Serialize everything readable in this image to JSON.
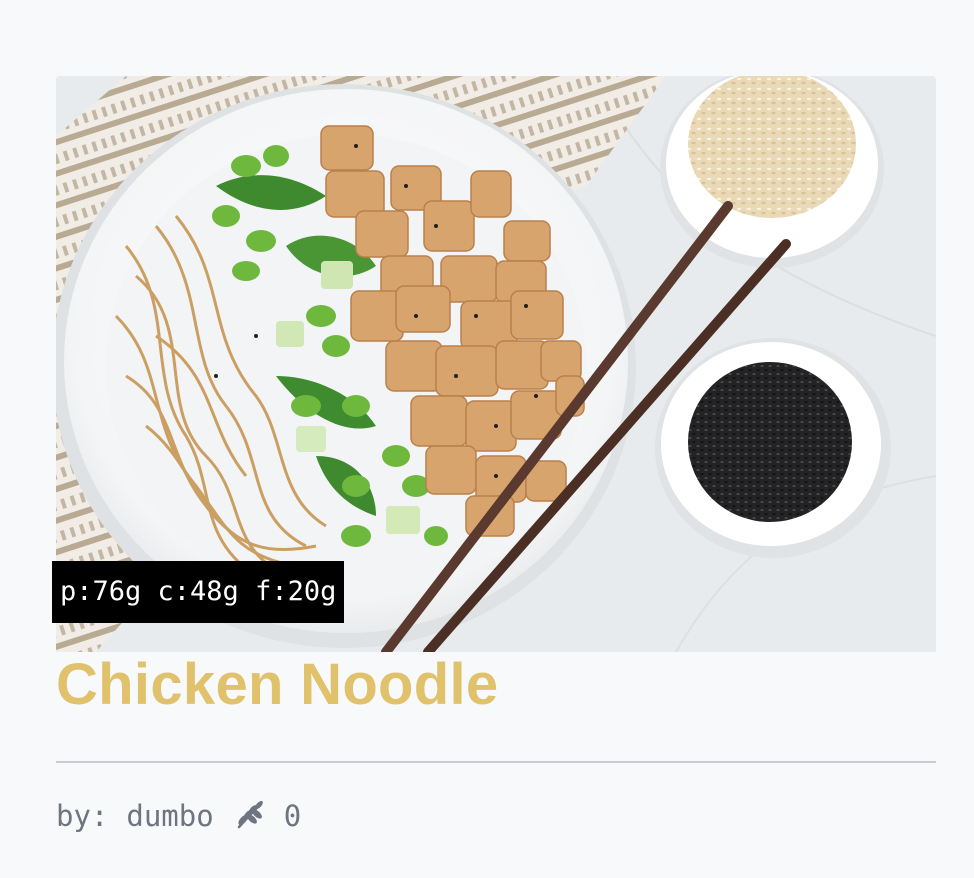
{
  "recipe": {
    "title": "Chicken Noodle",
    "macros": "p:76g c:48g f:20g",
    "author_prefix": "by:",
    "author": "dumbo",
    "likes_count": "0",
    "likes_icon": "wheat-icon"
  },
  "colors": {
    "title": "#e1c26c",
    "meta_text": "#6e7480",
    "page_background": "#f8f9fb",
    "badge_background": "#000000",
    "badge_text": "#ffffff"
  }
}
